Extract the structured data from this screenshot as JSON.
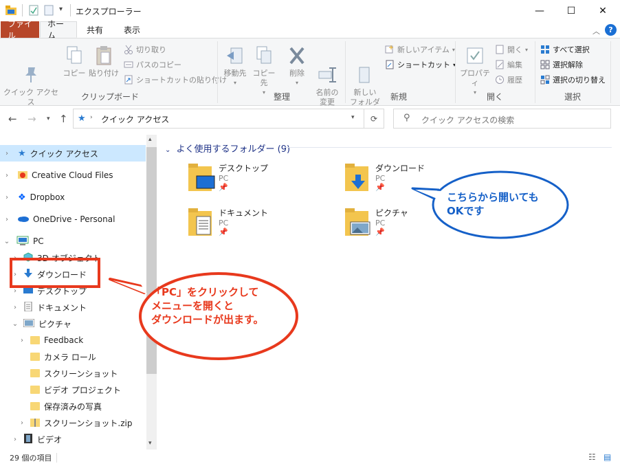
{
  "window": {
    "title": "エクスプローラー",
    "minimize": "—",
    "maximize": "☐",
    "close": "✕"
  },
  "ribbon_tabs": [
    "ファイル",
    "ホーム",
    "共有",
    "表示"
  ],
  "ribbon": {
    "clipboard": {
      "pin_label": "クイック アクセス\nにピン留めする",
      "copy_label": "コピー",
      "paste_label": "貼り付け",
      "cut_label": "切り取り",
      "copy_path_label": "パスのコピー",
      "paste_shortcut_label": "ショートカットの貼り付け",
      "group_label": "クリップボード"
    },
    "organize": {
      "move_to_label": "移動先",
      "copy_to_label": "コピー先",
      "delete_label": "削除",
      "rename_label": "名前の\n変更",
      "group_label": "整理"
    },
    "new": {
      "new_folder_label": "新しい\nフォルダー",
      "new_item_label": "新しいアイテム",
      "easy_access_label": "ショートカット",
      "group_label": "新規"
    },
    "open": {
      "properties_label": "プロパティ",
      "open_label": "開く",
      "edit_label": "編集",
      "history_label": "履歴",
      "group_label": "開く"
    },
    "select": {
      "select_all_label": "すべて選択",
      "select_none_label": "選択解除",
      "invert_selection_label": "選択の切り替え",
      "group_label": "選択"
    }
  },
  "address": {
    "path": "クイック アクセス",
    "search_placeholder": "クイック アクセスの検索"
  },
  "nav_items": [
    {
      "label": "クイック アクセス",
      "selected": true
    },
    {
      "label": "Creative Cloud Files"
    },
    {
      "label": "Dropbox"
    },
    {
      "label": "OneDrive - Personal"
    },
    {
      "label": "PC"
    },
    {
      "label": "3D オブジェクト"
    },
    {
      "label": "ダウンロード"
    },
    {
      "label": "デスクトップ"
    },
    {
      "label": "ドキュメント"
    },
    {
      "label": "ピクチャ"
    },
    {
      "label": "Feedback"
    },
    {
      "label": "カメラ ロール"
    },
    {
      "label": "スクリーンショット"
    },
    {
      "label": "ビデオ プロジェクト"
    },
    {
      "label": "保存済みの写真"
    },
    {
      "label": "スクリーンショット.zip"
    },
    {
      "label": "ビデオ"
    }
  ],
  "content": {
    "section_title": "よく使用するフォルダー (9)",
    "folders": [
      {
        "name": "デスクトップ",
        "location": "PC"
      },
      {
        "name": "ダウンロード",
        "location": "PC"
      },
      {
        "name": "ドキュメント",
        "location": "PC"
      },
      {
        "name": "ピクチャ",
        "location": "PC"
      }
    ]
  },
  "status": {
    "item_count": "29 個の項目"
  },
  "annotations": {
    "red_callout": [
      "「PC」をクリックして",
      "メニューを開くと",
      "ダウンロードが出ます。"
    ],
    "blue_callout": [
      "こちらから開いても",
      "OKです"
    ],
    "colors": {
      "red": "#e8391d",
      "blue": "#1560c8",
      "accent": "#0078d7",
      "file_tab": "#b7472a"
    }
  }
}
